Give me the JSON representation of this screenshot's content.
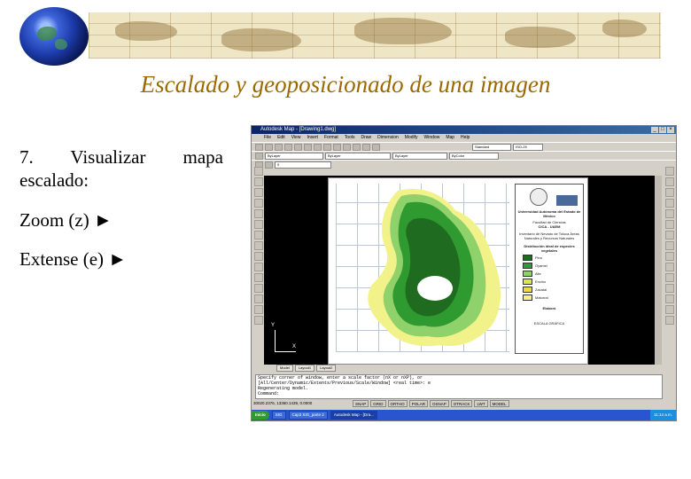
{
  "slide": {
    "title": "Escalado y  geoposicionado de una imagen",
    "step_text": "7.  Visualizar  mapa escalado:",
    "zoom_text": "Zoom (z) ►",
    "extense_text": "Extense (e) ►"
  },
  "window": {
    "title": "Autodesk Map - [Drawing1.dwg]",
    "menus": [
      "File",
      "Edit",
      "View",
      "Insert",
      "Format",
      "Tools",
      "Draw",
      "Dimension",
      "Modify",
      "Window",
      "Map",
      "Help"
    ],
    "style_select": "Standard",
    "dim_select": "ISO-25",
    "layer_select": "ByLayer",
    "linetype_select": "ByLayer",
    "lineweight_select": "ByLayer",
    "color_select": "ByColor",
    "layer_name": "0",
    "tabs": [
      "Model",
      "Layout1",
      "Layout2"
    ],
    "command_lines": [
      "Specify corner of window, enter a scale factor (nX or nXP), or",
      "[All/Center/Dynamic/Extents/Previous/Scale/Window] <real time>: e",
      "Regenerating model.",
      "Command:"
    ],
    "coords": "30020.2376, 13360.1439, 0.0000",
    "status_buttons": [
      "SNAP",
      "GRID",
      "ORTHO",
      "POLAR",
      "OSNAP",
      "OTRACK",
      "LWT",
      "MODEL"
    ],
    "axis_x": "X",
    "axis_y": "Y"
  },
  "legend": {
    "institution": "Universidad Autónoma del Estado de México",
    "faculty": "Facultad de Ciencias",
    "center": "CICA - UAEM",
    "project": "Inventario de Nevado de Toluca Áreas Naturales y Recursos Naturales",
    "map_title": "Distribución ideal de especies vegetales",
    "items": [
      {
        "label": "Pino",
        "color": "#1f6b1f"
      },
      {
        "label": "Oyamel",
        "color": "#2f9a2f"
      },
      {
        "label": "Aile",
        "color": "#8fd16b"
      },
      {
        "label": "Encino",
        "color": "#d8e84a"
      },
      {
        "label": "Zacatal",
        "color": "#e8d84a"
      },
      {
        "label": "Matorral",
        "color": "#f2f28a"
      }
    ],
    "author": "Elaboró",
    "scale_label": "ESCALA GRÁFICA"
  },
  "taskbar": {
    "start": "Inicio",
    "tasks": [
      "SIG",
      "Cap3 SIG_parte 2",
      "Autodesk Map - [Dra..."
    ],
    "clock": "11:14 a.m."
  },
  "colors": {
    "title": "#9a6a00",
    "titlebar": "#0a246a",
    "canvas": "#000000"
  }
}
